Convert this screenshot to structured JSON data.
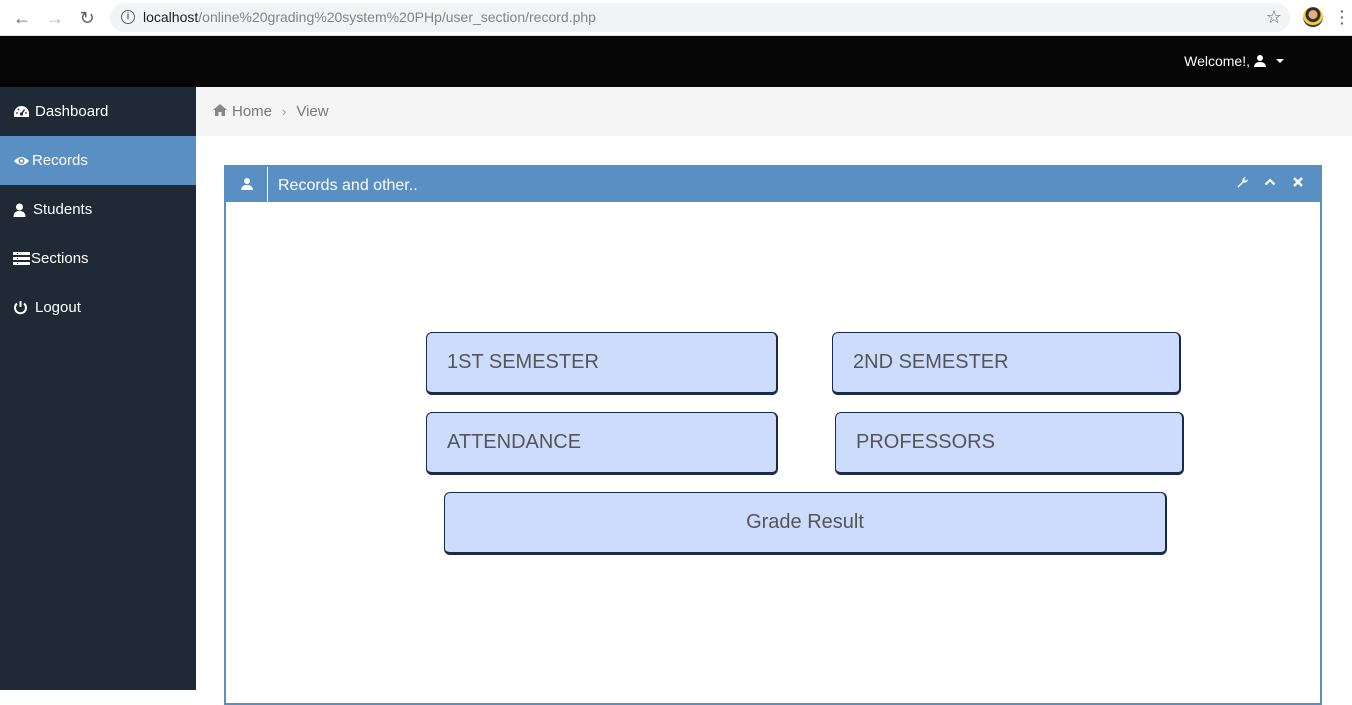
{
  "browser": {
    "url_host": "localhost",
    "url_path": "/online%20grading%20system%20PHp/user_section/record.php"
  },
  "header": {
    "welcome": "Welcome!,"
  },
  "sidebar": {
    "items": [
      {
        "label": "Dashboard",
        "icon": "dashboard-icon"
      },
      {
        "label": "Records",
        "icon": "eye-icon"
      },
      {
        "label": "Students",
        "icon": "user-icon"
      },
      {
        "label": "Sections",
        "icon": "list-icon"
      },
      {
        "label": "Logout",
        "icon": "power-icon"
      }
    ],
    "active": "Records"
  },
  "breadcrumb": {
    "home": "Home",
    "current": "View"
  },
  "panel": {
    "title": "Records and other..",
    "buttons": {
      "first_semester": "1ST SEMESTER",
      "second_semester": "2ND SEMESTER",
      "attendance": "ATTENDANCE",
      "professors": "PROFESSORS",
      "grade_result": "Grade Result"
    }
  },
  "colors": {
    "header_bg": "#060606",
    "sidebar_bg": "#1f2a36",
    "accent": "#5a8fc4",
    "button_bg": "#cddcfc"
  }
}
